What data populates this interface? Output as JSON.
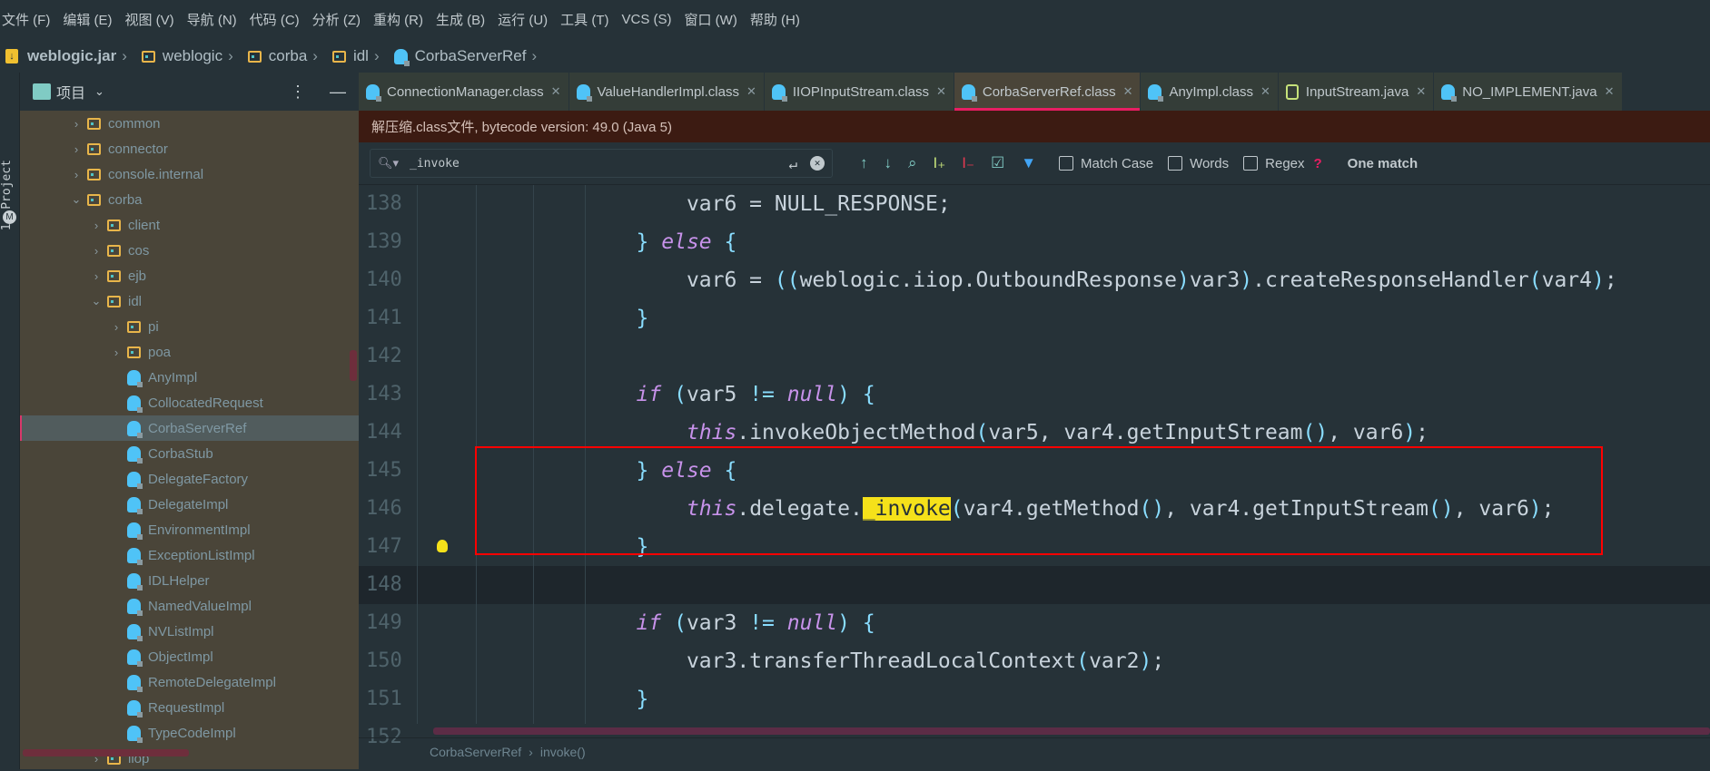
{
  "menu": [
    "文件 (F)",
    "编辑 (E)",
    "视图 (V)",
    "导航 (N)",
    "代码 (C)",
    "分析 (Z)",
    "重构 (R)",
    "生成 (B)",
    "运行 (U)",
    "工具 (T)",
    "VCS (S)",
    "窗口 (W)",
    "帮助 (H)"
  ],
  "breadcrumb": {
    "jar": "weblogic.jar",
    "items": [
      "weblogic",
      "corba",
      "idl"
    ],
    "cls": "CorbaServerRef"
  },
  "toolstrip": {
    "label": "1: Project",
    "icon": "M"
  },
  "project": {
    "title": "项目",
    "tree": [
      {
        "label": "common",
        "type": "folder",
        "depth": 0,
        "arrow": "›"
      },
      {
        "label": "connector",
        "type": "folder",
        "depth": 0,
        "arrow": "›"
      },
      {
        "label": "console.internal",
        "type": "folder",
        "depth": 0,
        "arrow": "›"
      },
      {
        "label": "corba",
        "type": "folder",
        "depth": 0,
        "arrow": "⌄"
      },
      {
        "label": "client",
        "type": "folder",
        "depth": 1,
        "arrow": "›"
      },
      {
        "label": "cos",
        "type": "folder",
        "depth": 1,
        "arrow": "›"
      },
      {
        "label": "ejb",
        "type": "folder",
        "depth": 1,
        "arrow": "›"
      },
      {
        "label": "idl",
        "type": "folder",
        "depth": 1,
        "arrow": "⌄"
      },
      {
        "label": "pi",
        "type": "folder",
        "depth": 2,
        "arrow": "›"
      },
      {
        "label": "poa",
        "type": "folder",
        "depth": 2,
        "arrow": "›"
      },
      {
        "label": "AnyImpl",
        "type": "class",
        "depth": 2
      },
      {
        "label": "CollocatedRequest",
        "type": "class",
        "depth": 2
      },
      {
        "label": "CorbaServerRef",
        "type": "class",
        "depth": 2,
        "selected": true
      },
      {
        "label": "CorbaStub",
        "type": "class",
        "depth": 2
      },
      {
        "label": "DelegateFactory",
        "type": "class",
        "depth": 2
      },
      {
        "label": "DelegateImpl",
        "type": "class",
        "depth": 2
      },
      {
        "label": "EnvironmentImpl",
        "type": "class",
        "depth": 2
      },
      {
        "label": "ExceptionListImpl",
        "type": "class",
        "depth": 2
      },
      {
        "label": "IDLHelper",
        "type": "class",
        "depth": 2
      },
      {
        "label": "NamedValueImpl",
        "type": "class",
        "depth": 2
      },
      {
        "label": "NVListImpl",
        "type": "class",
        "depth": 2
      },
      {
        "label": "ObjectImpl",
        "type": "class",
        "depth": 2
      },
      {
        "label": "RemoteDelegateImpl",
        "type": "class",
        "depth": 2
      },
      {
        "label": "RequestImpl",
        "type": "class",
        "depth": 2
      },
      {
        "label": "TypeCodeImpl",
        "type": "class",
        "depth": 2
      },
      {
        "label": "iiop",
        "type": "folder",
        "depth": 1,
        "arrow": "›"
      }
    ]
  },
  "tabs": [
    {
      "label": "ConnectionManager.class",
      "icon": "class"
    },
    {
      "label": "ValueHandlerImpl.class",
      "icon": "class"
    },
    {
      "label": "IIOPInputStream.class",
      "icon": "class"
    },
    {
      "label": "CorbaServerRef.class",
      "icon": "class",
      "active": true
    },
    {
      "label": "AnyImpl.class",
      "icon": "class"
    },
    {
      "label": "InputStream.java",
      "icon": "interface"
    },
    {
      "label": "NO_IMPLEMENT.java",
      "icon": "class"
    }
  ],
  "banner": "解压缩.class文件, bytecode version: 49.0 (Java 5)",
  "search": {
    "value": "_invoke",
    "match_case": "Match Case",
    "words": "Words",
    "regex": "Regex",
    "help": "?",
    "result": "One match"
  },
  "code": [
    {
      "n": "138",
      "t": [
        [
          "",
          "                    var6 = NULL_RESPONSE;"
        ]
      ]
    },
    {
      "n": "139",
      "t": [
        [
          "pu",
          "                }"
        ],
        [
          "",
          " "
        ],
        [
          "kw",
          "else"
        ],
        [
          "pu",
          " {"
        ]
      ]
    },
    {
      "n": "140",
      "t": [
        [
          "",
          "                    var6 = "
        ],
        [
          "pu",
          "(("
        ],
        [
          "",
          "weblogic.iiop.OutboundResponse"
        ],
        [
          "pu",
          ")"
        ],
        [
          "",
          "var3"
        ],
        [
          "pu",
          ")"
        ],
        [
          "",
          ".createResponseHandler"
        ],
        [
          "pu",
          "("
        ],
        [
          "",
          "var4"
        ],
        [
          "pu",
          ")"
        ],
        [
          "",
          ";"
        ]
      ]
    },
    {
      "n": "141",
      "t": [
        [
          "pu",
          "                }"
        ]
      ]
    },
    {
      "n": "142",
      "t": []
    },
    {
      "n": "143",
      "t": [
        [
          "kw",
          "                if"
        ],
        [
          "pu",
          " ("
        ],
        [
          "",
          "var5 "
        ],
        [
          "pu",
          "!="
        ],
        [
          "",
          " "
        ],
        [
          "kw",
          "null"
        ],
        [
          "pu",
          ") {"
        ]
      ]
    },
    {
      "n": "144",
      "t": [
        [
          "kw",
          "                    this"
        ],
        [
          "",
          ".invokeObjectMethod"
        ],
        [
          "pu",
          "("
        ],
        [
          "",
          "var5, var4.getInputStream"
        ],
        [
          "pu",
          "()"
        ],
        [
          "",
          ", var6"
        ],
        [
          "pu",
          ")"
        ],
        [
          "",
          ";"
        ]
      ]
    },
    {
      "n": "145",
      "t": [
        [
          "pu",
          "                }"
        ],
        [
          "",
          " "
        ],
        [
          "kw",
          "else"
        ],
        [
          "pu",
          " {"
        ]
      ]
    },
    {
      "n": "146",
      "t": [
        [
          "kw",
          "                    this"
        ],
        [
          "",
          ".delegate."
        ],
        [
          "hl",
          "_invoke"
        ],
        [
          "pu",
          "("
        ],
        [
          "",
          "var4.getMethod"
        ],
        [
          "pu",
          "()"
        ],
        [
          "",
          ", var4.getInputStream"
        ],
        [
          "pu",
          "()"
        ],
        [
          "",
          ", var6"
        ],
        [
          "pu",
          ")"
        ],
        [
          "",
          ";"
        ]
      ]
    },
    {
      "n": "147",
      "t": [
        [
          "pu",
          "                }"
        ]
      ]
    },
    {
      "n": "148",
      "t": [],
      "current": true
    },
    {
      "n": "149",
      "t": [
        [
          "kw",
          "                if"
        ],
        [
          "pu",
          " ("
        ],
        [
          "",
          "var3 "
        ],
        [
          "pu",
          "!="
        ],
        [
          "",
          " "
        ],
        [
          "kw",
          "null"
        ],
        [
          "pu",
          ") {"
        ]
      ]
    },
    {
      "n": "150",
      "t": [
        [
          "",
          "                    var3.transferThreadLocalContext"
        ],
        [
          "pu",
          "("
        ],
        [
          "",
          "var2"
        ],
        [
          "pu",
          ")"
        ],
        [
          "",
          ";"
        ]
      ]
    },
    {
      "n": "151",
      "t": [
        [
          "pu",
          "                }"
        ]
      ]
    },
    {
      "n": "152",
      "t": []
    }
  ],
  "footer": {
    "cls": "CorbaServerRef",
    "method": "invoke()"
  },
  "colors": {
    "accent": "#e91e63",
    "highlight": "#f5e11a",
    "annotation": "#ff0000",
    "keyword": "#c792ea"
  }
}
